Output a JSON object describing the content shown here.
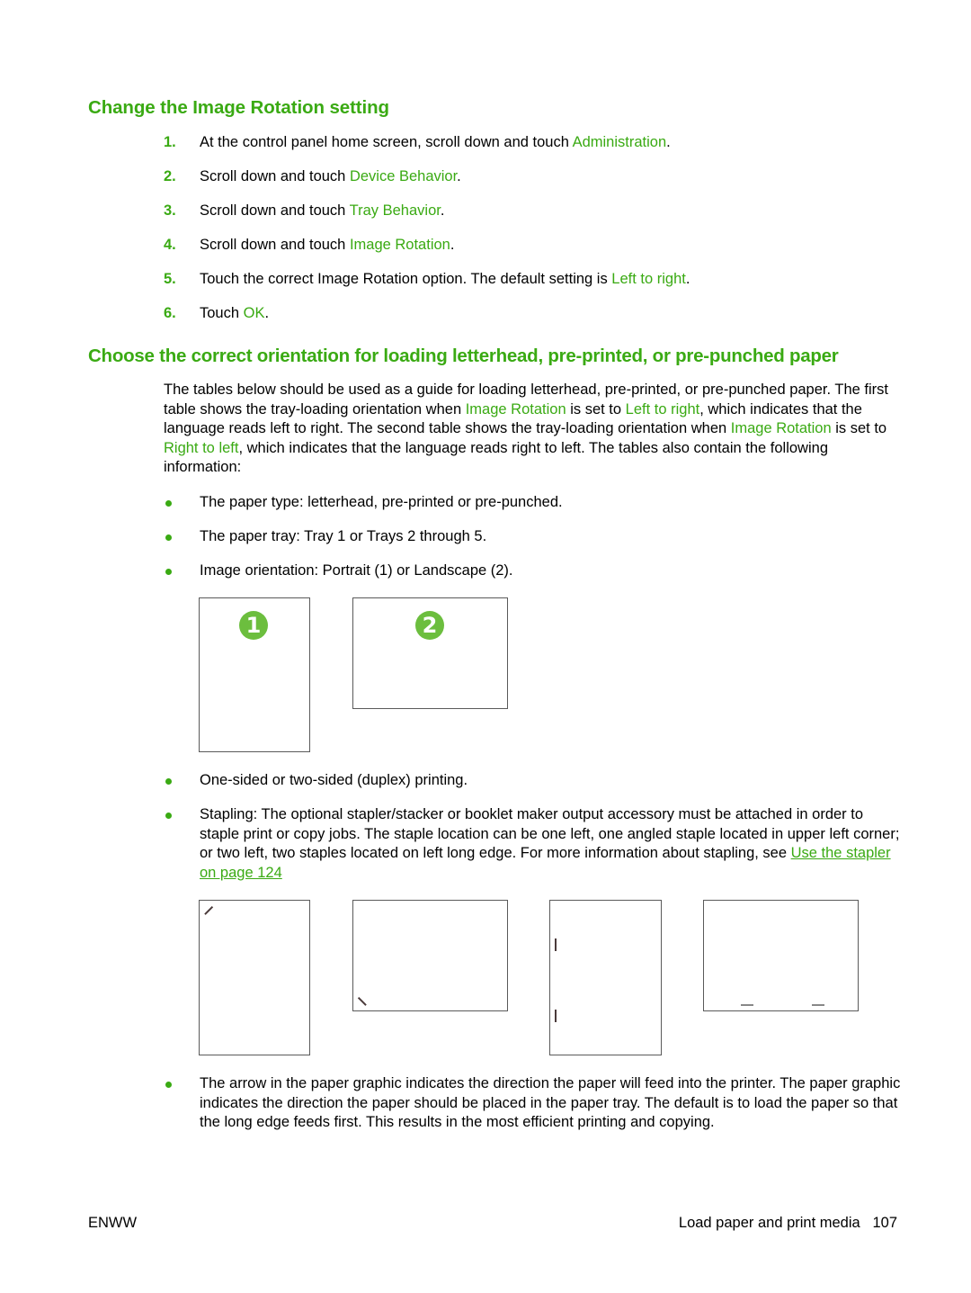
{
  "section1": {
    "heading": "Change the Image Rotation setting",
    "steps": [
      {
        "num": "1.",
        "pre": "At the control panel home screen, scroll down and touch ",
        "link": "Administration",
        "post": "."
      },
      {
        "num": "2.",
        "pre": "Scroll down and touch ",
        "link": "Device Behavior",
        "post": "."
      },
      {
        "num": "3.",
        "pre": "Scroll down and touch ",
        "link": "Tray Behavior",
        "post": "."
      },
      {
        "num": "4.",
        "pre": "Scroll down and touch ",
        "link": "Image Rotation",
        "post": "."
      },
      {
        "num": "5.",
        "pre": "Touch the correct Image Rotation option. The default setting is ",
        "link": "Left to right",
        "post": "."
      },
      {
        "num": "6.",
        "pre": "Touch ",
        "link": "OK",
        "post": "."
      }
    ]
  },
  "section2": {
    "heading": "Choose the correct orientation for loading letterhead, pre-printed, or pre-punched paper",
    "intro": {
      "t1": "The tables below should be used as a guide for loading letterhead, pre-printed, or pre-punched paper. The first table shows the tray-loading orientation when ",
      "l1": "Image Rotation",
      "t2": " is set to ",
      "l2": "Left to right",
      "t3": ", which indicates that the language reads left to right. The second table shows the tray-loading orientation when ",
      "l3": "Image Rotation",
      "t4": " is set to ",
      "l4": "Right to left",
      "t5": ", which indicates that the language reads right to left. The tables also contain the following information:"
    },
    "bullets": [
      "The paper type: letterhead, pre-printed or pre-punched.",
      "The paper tray: Tray 1 or Trays 2 through 5.",
      "Image orientation: Portrait (1) or Landscape (2)."
    ],
    "orientation_badges": [
      "1",
      "2"
    ],
    "bullet_duplex": "One-sided or two-sided (duplex) printing.",
    "bullet_stapling": {
      "text": "Stapling: The optional stapler/stacker or booklet maker output accessory must be attached in order to staple print or copy jobs. The staple location can be one left, one angled staple located in upper left corner; or two left, two staples located on left long edge. For more information about stapling, see ",
      "link": "Use the stapler on page 124"
    },
    "bullet_arrow": "The arrow in the paper graphic indicates the direction the paper will feed into the printer. The paper graphic indicates the direction the paper should be placed in the paper tray. The default is to load the paper so that the long edge feeds first. This results in the most efficient printing and copying."
  },
  "footer": {
    "left": "ENWW",
    "right_label": "Load paper and print media",
    "page_number": "107"
  }
}
